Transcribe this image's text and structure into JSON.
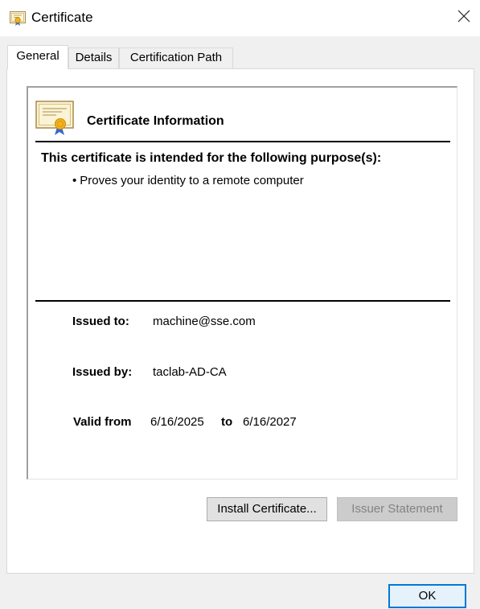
{
  "window": {
    "title": "Certificate",
    "icon": "certificate-icon",
    "close_icon": "close-icon"
  },
  "tabs": [
    {
      "label": "General",
      "active": true
    },
    {
      "label": "Details",
      "active": false
    },
    {
      "label": "Certification Path",
      "active": false
    }
  ],
  "general": {
    "heading": "Certificate Information",
    "purpose_heading": "This certificate is intended for the following purpose(s):",
    "purposes": [
      {
        "bullet": "•",
        "text": "Proves your identity to a remote computer"
      }
    ],
    "issued_to_label": "Issued to:",
    "issued_to": "machine@sse.com",
    "issued_by_label": "Issued by:",
    "issued_by": "taclab-AD-CA",
    "valid_from_label": "Valid from",
    "valid_from": "6/16/2025",
    "valid_to_label": "to",
    "valid_to": "6/16/2027"
  },
  "buttons": {
    "install": "Install Certificate...",
    "issuer_statement": "Issuer Statement",
    "issuer_statement_enabled": false,
    "ok": "OK"
  },
  "colors": {
    "accent": "#0078d7",
    "disabled_text": "#838383",
    "ribbon": "#3a66c9",
    "seal": "#f2b31c"
  }
}
